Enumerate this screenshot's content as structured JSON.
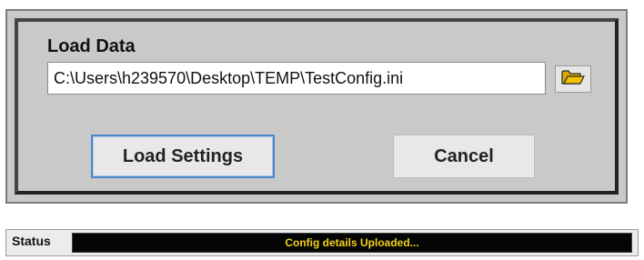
{
  "dialog": {
    "heading": "Load Data",
    "path_value": "C:\\Users\\h239570\\Desktop\\TEMP\\TestConfig.ini",
    "browse_icon": "folder-open-icon",
    "load_button_label": "Load Settings",
    "cancel_button_label": "Cancel"
  },
  "status": {
    "label": "Status",
    "message": "Config details Uploaded..."
  },
  "colors": {
    "dialog_background": "#c9c9c9",
    "focus_border": "#4a88c7",
    "status_background": "#050505",
    "status_text": "#f2d21a",
    "folder_icon": "#f2c200"
  }
}
